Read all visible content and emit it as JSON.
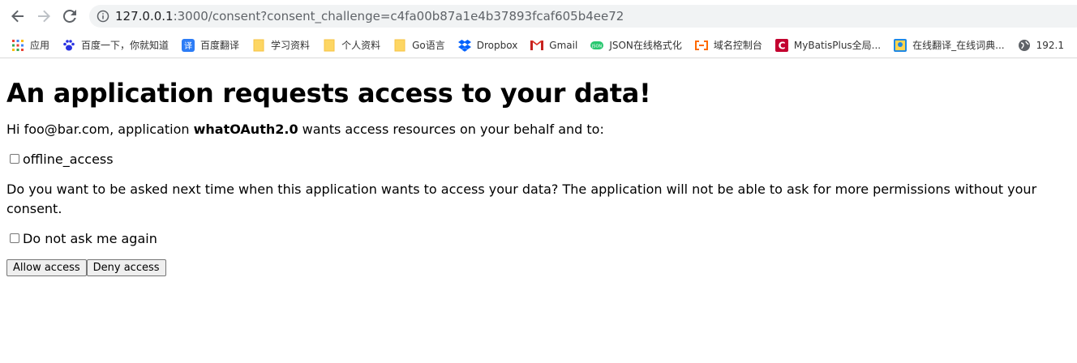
{
  "browser": {
    "url_host": "127.0.0.1",
    "url_rest": ":3000/consent?consent_challenge=c4fa00b87a1e4b37893fcaf605b4ee72"
  },
  "bookmarks": [
    {
      "label": "应用",
      "icon": "apps-grid-icon"
    },
    {
      "label": "百度一下，你就知道",
      "icon": "baidu-paw-icon"
    },
    {
      "label": "百度翻译",
      "icon": "translate-icon"
    },
    {
      "label": "学习资料",
      "icon": "folder-icon"
    },
    {
      "label": "个人资料",
      "icon": "folder-icon"
    },
    {
      "label": "Go语言",
      "icon": "folder-icon"
    },
    {
      "label": "Dropbox",
      "icon": "dropbox-icon"
    },
    {
      "label": "Gmail",
      "icon": "gmail-icon"
    },
    {
      "label": "JSON在线格式化",
      "icon": "json-icon"
    },
    {
      "label": "域名控制台",
      "icon": "cloud-console-icon"
    },
    {
      "label": "MyBatisPlus全局...",
      "icon": "red-c-icon"
    },
    {
      "label": "在线翻译_在线词典...",
      "icon": "dictionary-icon"
    },
    {
      "label": "192.1",
      "icon": "globe-icon"
    }
  ],
  "page": {
    "title": "An application requests access to your data!",
    "intro_prefix": "Hi foo@bar.com, application ",
    "app_name": "whatOAuth2.0",
    "intro_suffix": " wants access resources on your behalf and to:",
    "scope_label": "offline_access",
    "remember_question": "Do you want to be asked next time when this application wants to access your data? The application will not be able to ask for more permissions without your consent.",
    "remember_label": "Do not ask me again",
    "allow_label": "Allow access",
    "deny_label": "Deny access"
  }
}
